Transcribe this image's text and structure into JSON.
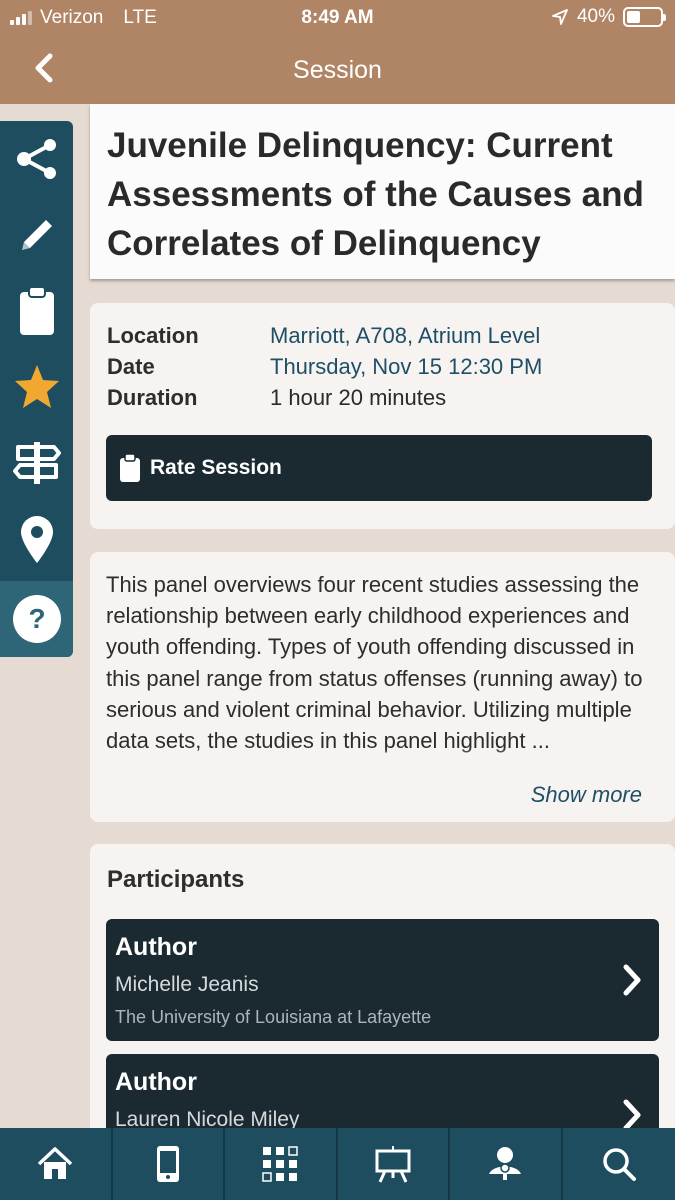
{
  "status_bar": {
    "carrier": "Verizon",
    "network": "LTE",
    "time": "8:49 AM",
    "battery": "40%",
    "battery_level": 0.4
  },
  "nav": {
    "title": "Session",
    "back_icon": "chevron-left-icon"
  },
  "side_toolbar": {
    "items": [
      "share-icon",
      "pencil-icon",
      "clipboard-icon",
      "star-icon",
      "signpost-icon",
      "map-pin-icon",
      "help-icon"
    ],
    "star_color": "#f0a830"
  },
  "session": {
    "title": "Juvenile Delinquency: Current Assessments of the Causes and Correlates of Delinquency",
    "location_label": "Location",
    "location": "Marriott, A708, Atrium Level",
    "date_label": "Date",
    "date": "Thursday, Nov 15 12:30 PM",
    "duration_label": "Duration",
    "duration": "1 hour 20 minutes",
    "rate_label": "Rate Session",
    "description": "This panel overviews four recent studies assessing the relationship between early childhood experiences and youth offending. Types of youth offending discussed in this panel range from status offenses (running away) to serious and violent criminal behavior. Utilizing multiple data sets, the studies in this panel highlight ...",
    "show_more": "Show more"
  },
  "participants": {
    "heading": "Participants",
    "items": [
      {
        "role": "Author",
        "name": "Michelle Jeanis",
        "org": "The University of Louisiana at Lafayette"
      },
      {
        "role": "Author",
        "name": "Lauren Nicole Miley",
        "org": ""
      }
    ]
  },
  "tab_bar": {
    "items": [
      "home-icon",
      "mobile-icon",
      "schedule-grid-icon",
      "presentation-icon",
      "speaker-icon",
      "search-icon"
    ]
  },
  "colors": {
    "header": "#b08565",
    "toolbar": "#1d4d5e",
    "dark_button": "#1b2a31",
    "link": "#1f4f66"
  }
}
